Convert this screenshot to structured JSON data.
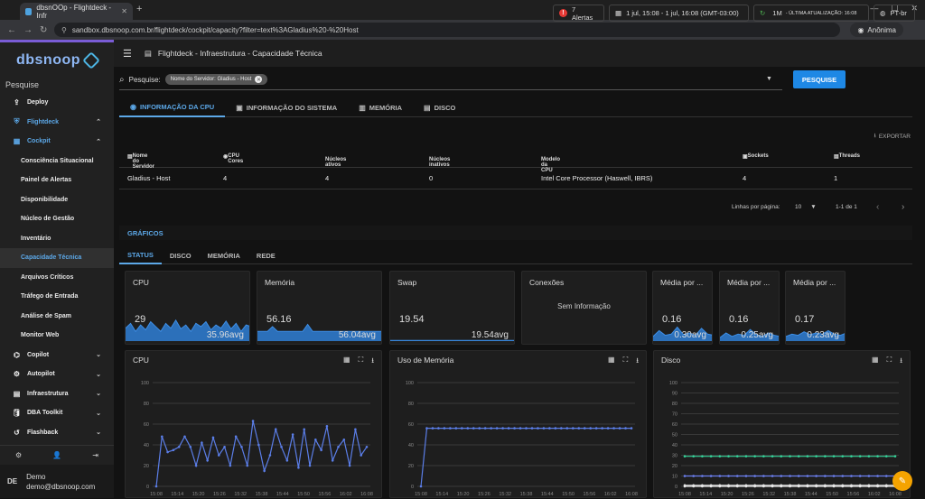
{
  "browser": {
    "tab_title": "dbsnOOp - Flightdeck - Infr",
    "url": "sandbox.dbsnoop.com.br/flightdeck/cockpit/capacity?filter=text%3AGladius%20-%20Host",
    "profile": "Anônima"
  },
  "sidebar": {
    "logo": "dbsnoop",
    "search_label": "Pesquise",
    "items": [
      {
        "label": "Deploy",
        "icon": "deploy-icon",
        "type": "main"
      },
      {
        "label": "Flightdeck",
        "icon": "shield-icon",
        "type": "blue"
      },
      {
        "label": "Cockpit",
        "icon": "dashboard-icon",
        "type": "blue"
      },
      {
        "label": "Consciência Situacional",
        "type": "sub"
      },
      {
        "label": "Painel de Alertas",
        "type": "sub"
      },
      {
        "label": "Disponibilidade",
        "type": "sub"
      },
      {
        "label": "Núcleo de Gestão",
        "type": "sub"
      },
      {
        "label": "Inventário",
        "type": "sub"
      },
      {
        "label": "Capacidade Técnica",
        "type": "active"
      },
      {
        "label": "Arquivos Críticos",
        "type": "sub"
      },
      {
        "label": "Tráfego de Entrada",
        "type": "sub"
      },
      {
        "label": "Análise de Spam",
        "type": "sub"
      },
      {
        "label": "Monitor Web",
        "type": "sub"
      },
      {
        "label": "Copilot",
        "icon": "copilot-icon",
        "type": "main"
      },
      {
        "label": "Autopilot",
        "icon": "autopilot-icon",
        "type": "main"
      },
      {
        "label": "Infraestrutura",
        "icon": "server-icon",
        "type": "main"
      },
      {
        "label": "DBA Toolkit",
        "icon": "toolkit-icon",
        "type": "main"
      },
      {
        "label": "Flashback",
        "icon": "flashback-icon",
        "type": "main"
      }
    ],
    "user": {
      "initials": "DE",
      "name": "Demo",
      "email": "demo@dbsnoop.com"
    }
  },
  "header": {
    "breadcrumb": "Flightdeck - Infraestrutura - Capacidade Técnica",
    "alerts": "7 Alertas",
    "date_range": "1 jul, 15:08 - 1 jul, 16:08 (GMT-03:00)",
    "interval": "1M",
    "last_update": "- ÚLTIMA ATUALIZAÇÃO: 16:08",
    "language": "PT-br"
  },
  "search": {
    "label": "Pesquise:",
    "chip": "Nome do Servidor: Gladius - Host",
    "button": "PESQUISE"
  },
  "tabs": [
    "INFORMAÇÃO DA CPU",
    "INFORMAÇÃO DO SISTEMA",
    "MEMÓRIA",
    "DISCO"
  ],
  "export_label": "EXPORTAR",
  "table": {
    "columns": [
      "Nome do Servidor",
      "CPU Cores",
      "Núcleos ativos",
      "Núcleos inativos",
      "Modelo da CPU",
      "Sockets",
      "Threads"
    ],
    "row": [
      "Gladius - Host",
      "4",
      "4",
      "0",
      "Intel Core Processor (Haswell, IBRS)",
      "4",
      "1"
    ],
    "rows_per_page_label": "Linhas por página:",
    "rows_per_page": "10",
    "range": "1-1 de 1"
  },
  "graficos_label": "GRÁFICOS",
  "sub_tabs": [
    "STATUS",
    "DISCO",
    "MEMÓRIA",
    "REDE"
  ],
  "cards": [
    {
      "title": "CPU",
      "value": "29",
      "avg": "35.96avg"
    },
    {
      "title": "Memória",
      "value": "56.16",
      "avg": "56.04avg"
    },
    {
      "title": "Swap",
      "value": "19.54",
      "avg": "19.54avg"
    },
    {
      "title": "Conexões",
      "empty": "Sem Informação"
    },
    {
      "title": "Média por ...",
      "value": "0.16",
      "avg": "0.30avg"
    },
    {
      "title": "Média por ...",
      "value": "0.16",
      "avg": "0.25avg"
    },
    {
      "title": "Média por ...",
      "value": "0.17",
      "avg": "0.23avg"
    }
  ],
  "chart_data": [
    {
      "type": "line",
      "title": "CPU",
      "x": [
        "15:08",
        "15:14",
        "15:20",
        "15:26",
        "15:32",
        "15:38",
        "15:44",
        "15:50",
        "15:56",
        "16:02",
        "16:08"
      ],
      "ylim": [
        0,
        100
      ],
      "yticks": [
        0,
        20,
        40,
        60,
        80,
        100
      ],
      "series": [
        {
          "values": [
            0,
            48,
            33,
            35,
            38,
            48,
            38,
            20,
            42,
            25,
            47,
            30,
            38,
            20,
            48,
            38,
            20,
            63,
            40,
            15,
            30,
            55,
            38,
            25,
            50,
            18,
            55,
            20,
            45,
            35,
            58,
            25,
            38,
            45,
            20,
            55,
            30,
            38
          ]
        }
      ]
    },
    {
      "type": "line",
      "title": "Uso de Memória",
      "x": [
        "15:08",
        "15:14",
        "15:20",
        "15:26",
        "15:32",
        "15:38",
        "15:44",
        "15:50",
        "15:56",
        "16:02",
        "16:08"
      ],
      "ylim": [
        0,
        100
      ],
      "yticks": [
        0,
        20,
        40,
        60,
        80,
        100
      ],
      "series": [
        {
          "values": [
            0,
            56,
            56,
            56,
            56,
            56,
            56,
            56,
            56,
            56,
            56,
            56,
            56,
            56,
            56,
            56,
            56,
            56,
            56,
            56,
            56,
            56,
            56,
            56,
            56,
            56,
            56,
            56,
            56,
            56,
            56,
            56,
            56,
            56,
            56,
            56,
            56
          ]
        }
      ]
    },
    {
      "type": "line",
      "title": "Disco",
      "x": [
        "15:08",
        "15:14",
        "15:20",
        "15:26",
        "15:32",
        "15:38",
        "15:44",
        "15:50",
        "15:56",
        "16:02",
        "16:08"
      ],
      "ylim": [
        0,
        100
      ],
      "yticks": [
        0,
        10,
        20,
        30,
        40,
        50,
        60,
        70,
        80,
        90,
        100
      ],
      "series": [
        {
          "values": [
            29,
            29,
            29,
            29,
            29,
            29,
            29,
            29,
            29,
            29,
            29,
            29,
            29,
            29,
            29,
            29,
            29,
            29,
            29,
            29,
            29,
            29,
            29,
            29,
            29
          ],
          "color": "#34d399"
        },
        {
          "values": [
            10,
            10,
            10,
            10,
            10,
            10,
            10,
            10,
            10,
            10,
            10,
            10,
            10,
            10,
            10,
            10,
            10,
            10,
            10,
            10,
            10,
            10,
            10,
            10,
            10
          ],
          "color": "#6b7ff0"
        },
        {
          "values": [
            1,
            1,
            1,
            1,
            1,
            1,
            1,
            1,
            1,
            1,
            1,
            1,
            1,
            1,
            1,
            1,
            1,
            1,
            1,
            1,
            1,
            1,
            1,
            1,
            1
          ],
          "color": "#e8e8e8"
        },
        {
          "values": [
            0,
            0,
            0,
            0,
            0,
            0,
            0,
            0,
            0,
            0,
            0,
            0,
            0,
            0,
            0,
            0,
            0,
            0,
            0,
            0,
            0,
            0,
            0,
            0,
            0
          ],
          "color": "#e8e8e8"
        }
      ]
    }
  ],
  "card_sparks": {
    "cpu": [
      40,
      55,
      30,
      50,
      35,
      60,
      45,
      30,
      55,
      40,
      65,
      38,
      50,
      30,
      55,
      45,
      60,
      35,
      50,
      40,
      62,
      38,
      55,
      30,
      50,
      45
    ],
    "mem": [
      30,
      30,
      30,
      45,
      30,
      30,
      30,
      30,
      30,
      30,
      52,
      30,
      30,
      30,
      30,
      30,
      30,
      30,
      30,
      30,
      30,
      30,
      30,
      30,
      30,
      30
    ],
    "swap": [
      2,
      2,
      2,
      2,
      2,
      2,
      2,
      2,
      2,
      2,
      2,
      2,
      2,
      2,
      2,
      2,
      2,
      2,
      2,
      2,
      2,
      2,
      2,
      2,
      2,
      2
    ],
    "m1": [
      20,
      45,
      25,
      30,
      60,
      28,
      35,
      25,
      55,
      30,
      25
    ],
    "m2": [
      15,
      35,
      20,
      30,
      25,
      50,
      28,
      20,
      35,
      25,
      20
    ],
    "m3": [
      20,
      30,
      25,
      40,
      28,
      35,
      30,
      45,
      30,
      25,
      35
    ]
  },
  "colors": {
    "accent": "#1e88e5",
    "line": "#5b7ee8",
    "fill": "#2f7fd6"
  }
}
